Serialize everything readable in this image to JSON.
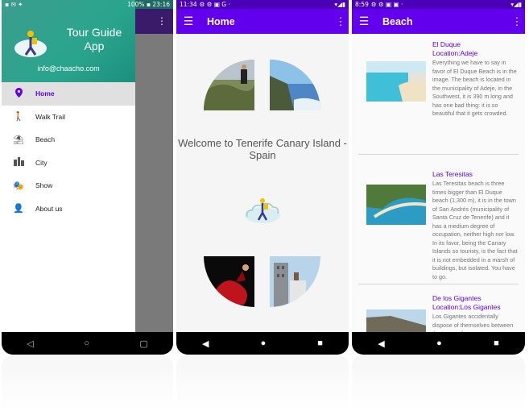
{
  "phone1": {
    "status": {
      "right": "100% ▪ 23:16"
    },
    "drawer": {
      "app_name": "Tour Guide App",
      "email": "info@chaacho.com",
      "items": [
        {
          "label": "Home",
          "icon": "location-pin-icon"
        },
        {
          "label": "Walk Trail",
          "icon": "walking-icon"
        },
        {
          "label": "Beach",
          "icon": "beach-icon"
        },
        {
          "label": "City",
          "icon": "city-icon"
        },
        {
          "label": "Show",
          "icon": "theater-masks-icon"
        },
        {
          "label": "About us",
          "icon": "person-question-icon"
        }
      ],
      "active_index": 0
    }
  },
  "phone2": {
    "status": {
      "time": "11:34"
    },
    "appbar": {
      "title": "Home"
    },
    "welcome": "Welcome to Tenerife Canary Island - Spain"
  },
  "phone3": {
    "status": {
      "time": "8:59"
    },
    "appbar": {
      "title": "Beach"
    },
    "beaches": [
      {
        "name": "El Duque",
        "location": "Location:Adeje",
        "description": "Everything we have to say in favor of El Duque Beach is in the image. The beach is located in the municipality of Adeje, in the Southwest, it is 390 m long and has one bad thing: it is so beautiful that it gets crowded."
      },
      {
        "name": "Las Teresitas",
        "location": "",
        "description": "Las Teresitas beach is three times bigger than El Duque beach (1,300 m), it is in the town of San Andrés (municipality of Santa Cruz de Tenerife) and it has a medium degree of occupation, neither high nor low. In its favor, being the Canary Islands so touristy, is the fact that it is not embedded in a marsh of buildings, but isolated. You have to go."
      },
      {
        "name": "De los Gigantes",
        "location": "Location:Los Gigantes",
        "description": "Los Gigantes accidentally dispose of themselves between the terms of"
      }
    ]
  },
  "colors": {
    "primary": "#6200ee",
    "drawer_header": "#2aa58d"
  }
}
